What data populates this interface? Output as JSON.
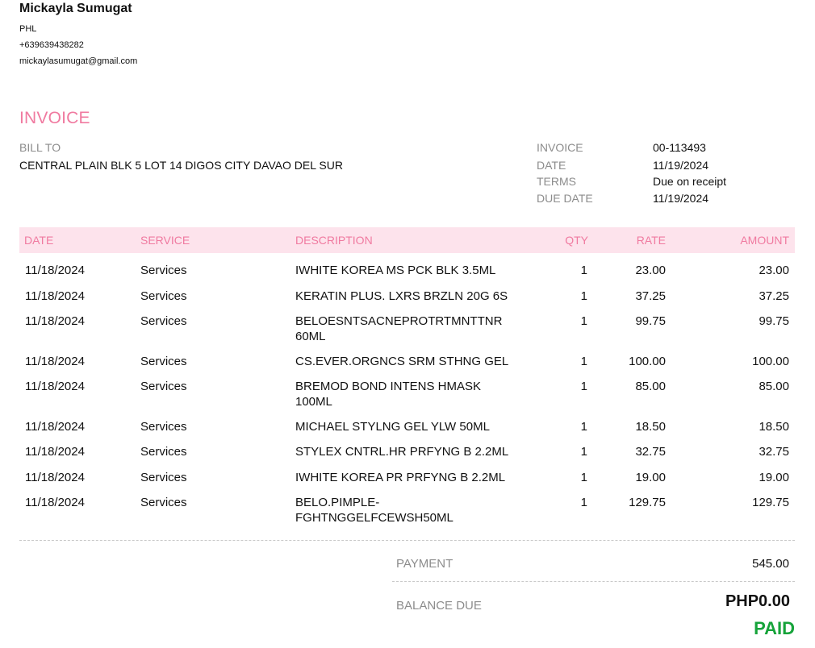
{
  "company": {
    "name": "Mickayla Sumugat",
    "country": "PHL",
    "phone": "+639639438282",
    "email": "mickaylasumugat@gmail.com"
  },
  "invoice": {
    "title": "INVOICE",
    "bill_to_label": "BILL TO",
    "bill_to_address": "CENTRAL PLAIN BLK 5 LOT 14 DIGOS CITY DAVAO DEL SUR",
    "meta": [
      {
        "label": "INVOICE",
        "value": "00-113493"
      },
      {
        "label": "DATE",
        "value": "11/19/2024"
      },
      {
        "label": "TERMS",
        "value": "Due on receipt"
      },
      {
        "label": "DUE DATE",
        "value": "11/19/2024"
      }
    ]
  },
  "table": {
    "headers": {
      "date": "DATE",
      "service": "SERVICE",
      "description": "DESCRIPTION",
      "qty": "QTY",
      "rate": "RATE",
      "amount": "AMOUNT"
    },
    "rows": [
      {
        "date": "11/18/2024",
        "service": "Services",
        "description": "IWHITE KOREA MS PCK BLK 3.5ML",
        "qty": "1",
        "rate": "23.00",
        "amount": "23.00"
      },
      {
        "date": "11/18/2024",
        "service": "Services",
        "description": "KERATIN PLUS. LXRS BRZLN 20G 6S",
        "qty": "1",
        "rate": "37.25",
        "amount": "37.25"
      },
      {
        "date": "11/18/2024",
        "service": "Services",
        "description": "BELOESNTSACNEPROTRTMNTTNR 60ML",
        "qty": "1",
        "rate": "99.75",
        "amount": "99.75"
      },
      {
        "date": "11/18/2024",
        "service": "Services",
        "description": "CS.EVER.ORGNCS SRM STHNG GEL",
        "qty": "1",
        "rate": "100.00",
        "amount": "100.00"
      },
      {
        "date": "11/18/2024",
        "service": "Services",
        "description": "BREMOD BOND INTENS HMASK 100ML",
        "qty": "1",
        "rate": "85.00",
        "amount": "85.00"
      },
      {
        "date": "11/18/2024",
        "service": "Services",
        "description": "MICHAEL STYLNG GEL YLW 50ML",
        "qty": "1",
        "rate": "18.50",
        "amount": "18.50"
      },
      {
        "date": "11/18/2024",
        "service": "Services",
        "description": "STYLEX CNTRL.HR PRFYNG B 2.2ML",
        "qty": "1",
        "rate": "32.75",
        "amount": "32.75"
      },
      {
        "date": "11/18/2024",
        "service": "Services",
        "description": "IWHITE KOREA PR PRFYNG B 2.2ML",
        "qty": "1",
        "rate": "19.00",
        "amount": "19.00"
      },
      {
        "date": "11/18/2024",
        "service": "Services",
        "description": "BELO.PIMPLE-FGHTNGGELFCEWSH50ML",
        "qty": "1",
        "rate": "129.75",
        "amount": "129.75"
      }
    ]
  },
  "totals": {
    "payment_label": "PAYMENT",
    "payment_value": "545.00",
    "balance_label": "BALANCE DUE",
    "balance_value": "PHP0.00",
    "status": "PAID"
  },
  "colors": {
    "accent": "#f07aa0",
    "header_band": "#fde3ec",
    "label_gray": "#8c8c8c",
    "paid_green": "#16a33a"
  }
}
